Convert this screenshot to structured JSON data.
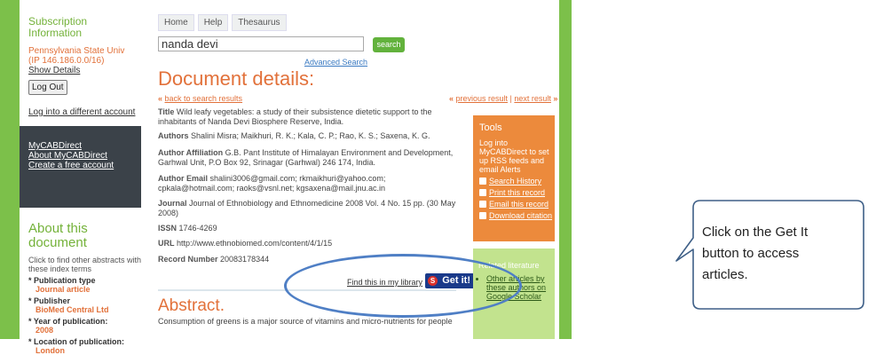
{
  "sidebar": {
    "subscription_title": "Subscription Information",
    "institution": "Pennsylvania State Univ",
    "ip": "(IP 146.186.0.0/16)",
    "show_details": "Show Details",
    "logout": "Log Out",
    "different_account": "Log into a different account",
    "dark_links": [
      "MyCABDirect",
      "About MyCABDirect",
      "Create a free account"
    ],
    "about_title": "About this document",
    "about_intro": "Click to find other abstracts with these index terms",
    "facets": [
      {
        "label": "* Publication type",
        "value": "Journal article"
      },
      {
        "label": "* Publisher",
        "value": "BioMed Central Ltd"
      },
      {
        "label": "* Year of publication:",
        "value": "2008"
      },
      {
        "label": "* Location of publication:",
        "value": "London"
      }
    ]
  },
  "tabs": [
    "Home",
    "Help",
    "Thesaurus"
  ],
  "search": {
    "value": "nanda devi",
    "button": "search",
    "advanced": "Advanced Search"
  },
  "doc": {
    "heading": "Document details:",
    "back": "back to search results",
    "back_prefix": "« ",
    "previous": "previous result",
    "next": "next result",
    "pn_prefix": "« ",
    "pn_sep": " | ",
    "pn_suffix": " »",
    "title_label": "Title",
    "title": "Wild leafy vegetables: a study of their subsistence dietetic support to the inhabitants of Nanda Devi Biosphere Reserve, India.",
    "authors_label": "Authors",
    "authors": "Shalini Misra; Maikhuri, R. K.; Kala, C. P.; Rao, K. S.; Saxena, K. G.",
    "affiliation_label": "Author Affiliation",
    "affiliation": "G.B. Pant Institute of Himalayan Environment and Development, Garhwal Unit, P.O Box 92, Srinagar (Garhwal) 246 174, India.",
    "email_label": "Author Email",
    "email": "shalini3006@gmail.com; rkmaikhuri@yahoo.com; cpkala@hotmail.com; raoks@vsnl.net; kgsaxena@mail.jnu.ac.in",
    "journal_label": "Journal",
    "journal": "Journal of Ethnobiology and Ethnomedicine 2008 Vol. 4 No. 15 pp. (30 May 2008)",
    "issn_label": "ISSN",
    "issn": "1746-4269",
    "url_label": "URL",
    "url": "http://www.ethnobiomed.com/content/4/1/15",
    "record_label": "Record Number",
    "record": "20083178344",
    "find_library": "Find this in my library",
    "getit": "Get it!",
    "abstract_heading": "Abstract.",
    "abstract_text": "Consumption of greens is a major source of vitamins and micro-nutrients for people"
  },
  "tools": {
    "title": "Tools",
    "desc": "Log into MyCABDirect to set up RSS feeds and email Alerts",
    "links": [
      "Search History",
      "Print this record",
      "Email this record",
      "Download citation"
    ]
  },
  "related": {
    "title": "Related literature",
    "links": [
      "Other articles by these authors on Google Scholar"
    ]
  },
  "callout": {
    "text": "Click on the Get It button to access articles."
  },
  "colors": {
    "green": "#7cc04a",
    "orange": "#e2713a",
    "tools_bg": "#ec8a3c",
    "dark": "#3b4249",
    "oval": "#4f7fc5"
  }
}
